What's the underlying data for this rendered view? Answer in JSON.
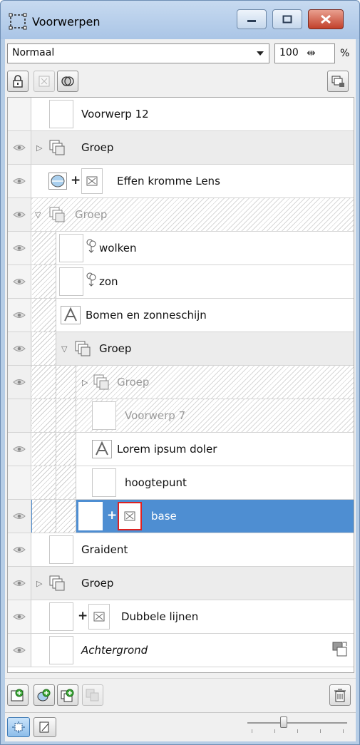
{
  "window": {
    "title": "Voorwerpen"
  },
  "toolbar": {
    "blend_mode": "Normaal",
    "opacity_value": "100",
    "opacity_unit": "%"
  },
  "icons": {
    "title": "layers-panel-icon",
    "minimize": "minimize-icon",
    "maximize": "maximize-icon",
    "close": "close-icon",
    "lock": "lock-icon",
    "mask": "mask-icon",
    "clip": "clip-icon",
    "lock_layer": "lock-layer-icon",
    "eye": "eye-icon",
    "text_layer": "text-layer-icon",
    "shape_layer": "shape-layer-icon",
    "group": "group-icon",
    "lens": "lens-icon",
    "frame": "frame-icon",
    "new_layer": "new-layer-icon",
    "new_adjustment": "new-adjustment-icon",
    "new_group": "new-group-icon",
    "merge": "merge-icon",
    "delete": "trash-icon",
    "view_thumbs": "view-thumbnails-icon",
    "view_list": "view-list-icon",
    "background_badge": "background-layer-icon"
  },
  "layers": [
    {
      "name": "Voorwerp 12",
      "visible": false,
      "level": 0,
      "kind": "object"
    },
    {
      "name": "Groep",
      "visible": true,
      "level": 0,
      "kind": "group",
      "expanded": false
    },
    {
      "name": "Effen kromme Lens",
      "visible": true,
      "level": 0,
      "kind": "lens"
    },
    {
      "name": "Groep",
      "visible": true,
      "level": 0,
      "kind": "group",
      "expanded": true,
      "dimmed": true
    },
    {
      "name": "wolken",
      "visible": true,
      "level": 1,
      "kind": "shape"
    },
    {
      "name": "zon",
      "visible": true,
      "level": 1,
      "kind": "shape"
    },
    {
      "name": "Bomen en zonneschijn",
      "visible": true,
      "level": 1,
      "kind": "text"
    },
    {
      "name": "Groep",
      "visible": true,
      "level": 1,
      "kind": "group",
      "expanded": true
    },
    {
      "name": "Groep",
      "visible": true,
      "level": 2,
      "kind": "group",
      "expanded": false,
      "dimmed": true
    },
    {
      "name": "Voorwerp 7",
      "visible": false,
      "level": 2,
      "kind": "object",
      "dimmed": true
    },
    {
      "name": "Lorem ipsum doler",
      "visible": true,
      "level": 2,
      "kind": "text"
    },
    {
      "name": "hoogtepunt",
      "visible": false,
      "level": 2,
      "kind": "object"
    },
    {
      "name": "base",
      "visible": true,
      "level": 2,
      "kind": "masked",
      "selected": true
    },
    {
      "name": "Graident",
      "visible": true,
      "level": 0,
      "kind": "object"
    },
    {
      "name": "Groep",
      "visible": true,
      "level": 0,
      "kind": "group",
      "expanded": false
    },
    {
      "name": "Dubbele lijnen",
      "visible": true,
      "level": 0,
      "kind": "masked"
    },
    {
      "name": "Achtergrond",
      "visible": true,
      "level": 0,
      "kind": "background"
    }
  ]
}
